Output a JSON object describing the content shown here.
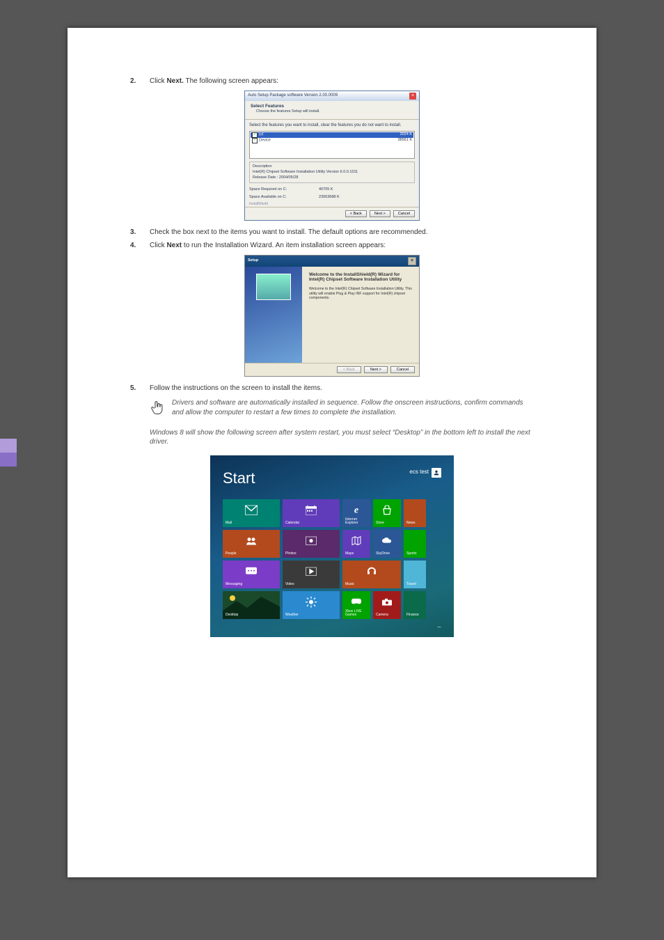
{
  "steps": {
    "s2": {
      "num": "2.",
      "text_a": "Click ",
      "bold": "Next.",
      "text_b": " The following screen appears:"
    },
    "s3": {
      "num": "3.",
      "text": "Check the box next to the items you want to install. The default options are recommended."
    },
    "s4": {
      "num": "4.",
      "text_a": "Click ",
      "bold": "Next",
      "text_b": " to run the Installation Wizard. An item installation screen appears:"
    },
    "s5": {
      "num": "5.",
      "text": "Follow the instructions on the screen to install the items."
    }
  },
  "dlg1": {
    "title": "Auto Setup Package software Version 2.00.0009",
    "hdr_t": "Select Features",
    "hdr_s": "Choose the features Setup will install.",
    "instr": "Select the features you want to install, clear the features you do not want to install.",
    "row1": {
      "name": "Inf",
      "size": "2024 K"
    },
    "row2": {
      "name": "Device",
      "size": "38561 K"
    },
    "desc_label": "Description",
    "desc_line1": "Intel(R) Chipset Software Installation Utility Version 6.0.0.1011",
    "desc_line2": "Release Date : 2004/05/28",
    "space_req_l": "Space Required on  C:",
    "space_req_v": "40705 K",
    "space_av_l": "Space Available on  C:",
    "space_av_v": "23063688 K",
    "brand": "InstallShield",
    "btn_back": "< Back",
    "btn_next": "Next >",
    "btn_cancel": "Cancel"
  },
  "dlg2": {
    "title": "Setup",
    "h1": "Welcome to the InstallShield(R) Wizard for Intel(R) Chipset Software Installation Utility",
    "p1": "Welcome to the Intel(R) Chipset Software Installation Utility.  This utility will enable Plug & Play INF support for Intel(R) chipset components.",
    "btn_back": "< Back",
    "btn_next": "Next >",
    "btn_cancel": "Cancel"
  },
  "note1": "Drivers and software are automatically installed in sequence. Follow the onscreen instructions, confirm commands and allow the computer to restart a few times to complete the installation.",
  "note2": "Windows 8 will show the following screen after system restart, you must select “Desktop” in the bottom left to install the next driver.",
  "start": {
    "title": "Start",
    "user": "ecs test",
    "tiles": {
      "mail": "Mail",
      "calendar": "Calendar",
      "ie": "Internet Explorer",
      "store": "Store",
      "news": "News",
      "people": "People",
      "photos": "Photos",
      "maps": "Maps",
      "skydrive": "SkyDrive",
      "sports": "Sports",
      "messaging": "Messaging",
      "video": "Video",
      "music": "Music",
      "travel": "Travel",
      "desktop": "Desktop",
      "weather": "Weather",
      "games": "Xbox LIVE Games",
      "camera": "Camera",
      "finance": "Finance"
    }
  }
}
